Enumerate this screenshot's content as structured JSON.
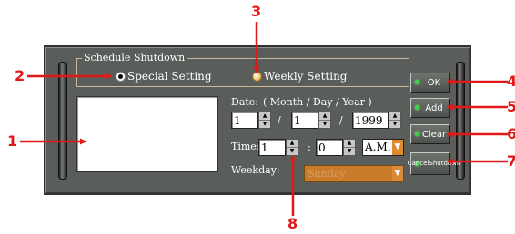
{
  "group": {
    "title": "Schedule Shutdown"
  },
  "mode": {
    "special_label": "Special Setting",
    "weekly_label": "Weekly Setting",
    "selected": "Special Setting"
  },
  "date": {
    "label": "Date:",
    "format": "( Month / Day / Year )",
    "month": "1",
    "day": "1",
    "year": "1999",
    "separator": "/"
  },
  "time": {
    "label": "Time:",
    "hour": "1",
    "separator": ":",
    "minute": "0",
    "ampm": "A.M."
  },
  "weekday": {
    "label": "Weekday:",
    "value": "Sunday"
  },
  "buttons": {
    "ok": "OK",
    "add": "Add",
    "clear": "Clear",
    "cancel_line1": "Cancel",
    "cancel_line2": "Shutdown"
  },
  "callouts": [
    "1",
    "2",
    "3",
    "4",
    "5",
    "6",
    "7",
    "8"
  ],
  "colors": {
    "callout": "#e01818",
    "led": "#3fd04a",
    "panel": "#5a5e5a",
    "accent_orange": "#e08a30"
  }
}
